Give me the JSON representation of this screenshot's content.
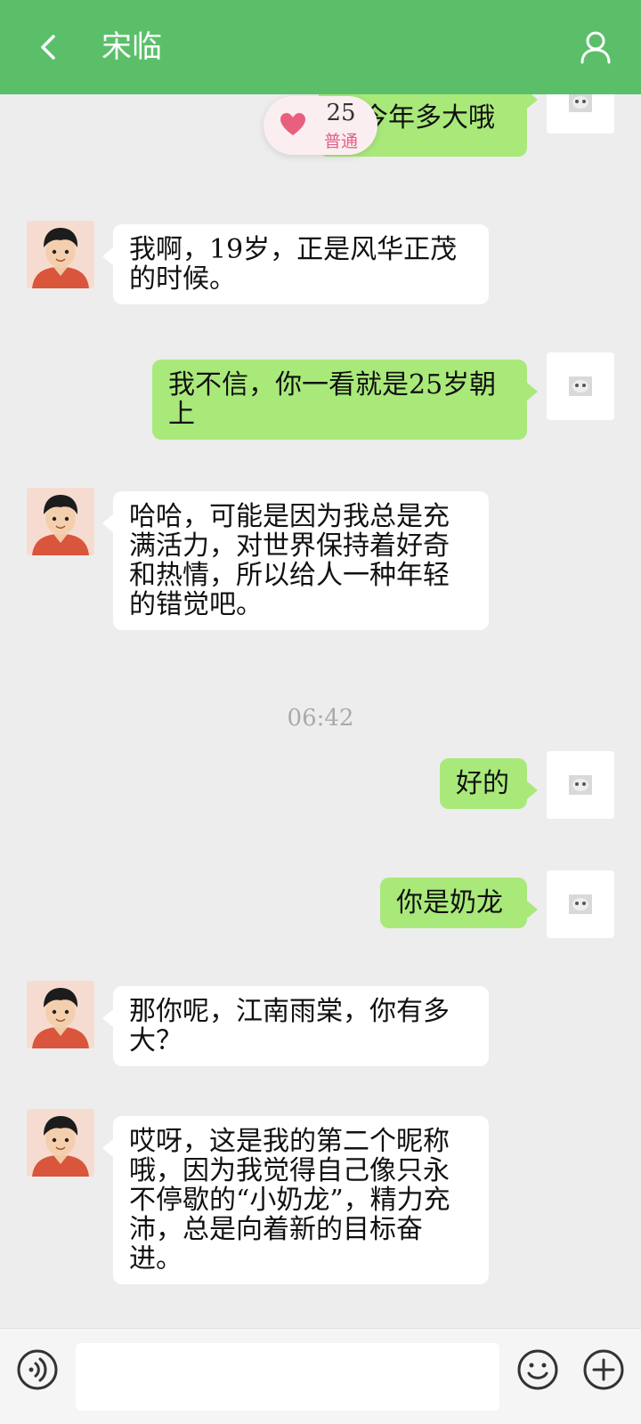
{
  "header": {
    "title": "宋临"
  },
  "badge": {
    "count": "25",
    "level": "普通"
  },
  "messages": [
    {
      "side": "right",
      "text": "你今年多大哦"
    },
    {
      "side": "left",
      "text": "我啊，19岁，正是风华正茂的时候。"
    },
    {
      "side": "right",
      "text": "我不信，你一看就是25岁朝上"
    },
    {
      "side": "left",
      "text": "哈哈，可能是因为我总是充满活力，对世界保持着好奇和热情，所以给人一种年轻的错觉吧。"
    },
    {
      "side": "right",
      "text": "好的"
    },
    {
      "side": "right",
      "text": "你是奶龙"
    },
    {
      "side": "left",
      "text": "那你呢，江南雨棠，你有多大？"
    },
    {
      "side": "left",
      "text": "哎呀，这是我的第二个昵称哦，因为我觉得自己像只永不停歇的“小奶龙”，精力充沛，总是向着新的目标奋进。"
    }
  ],
  "timestamp": "06:42",
  "input": {
    "value": ""
  },
  "colors": {
    "header": "#5bbf6a",
    "outgoing_bubble": "#a9e97a",
    "incoming_bubble": "#ffffff",
    "background": "#ededed"
  },
  "icons": {
    "back": "chevron-left-icon",
    "profile": "person-icon",
    "badge": "heart-icon",
    "voice": "voice-icon",
    "emoji": "smiley-icon",
    "more": "plus-circle-icon"
  }
}
